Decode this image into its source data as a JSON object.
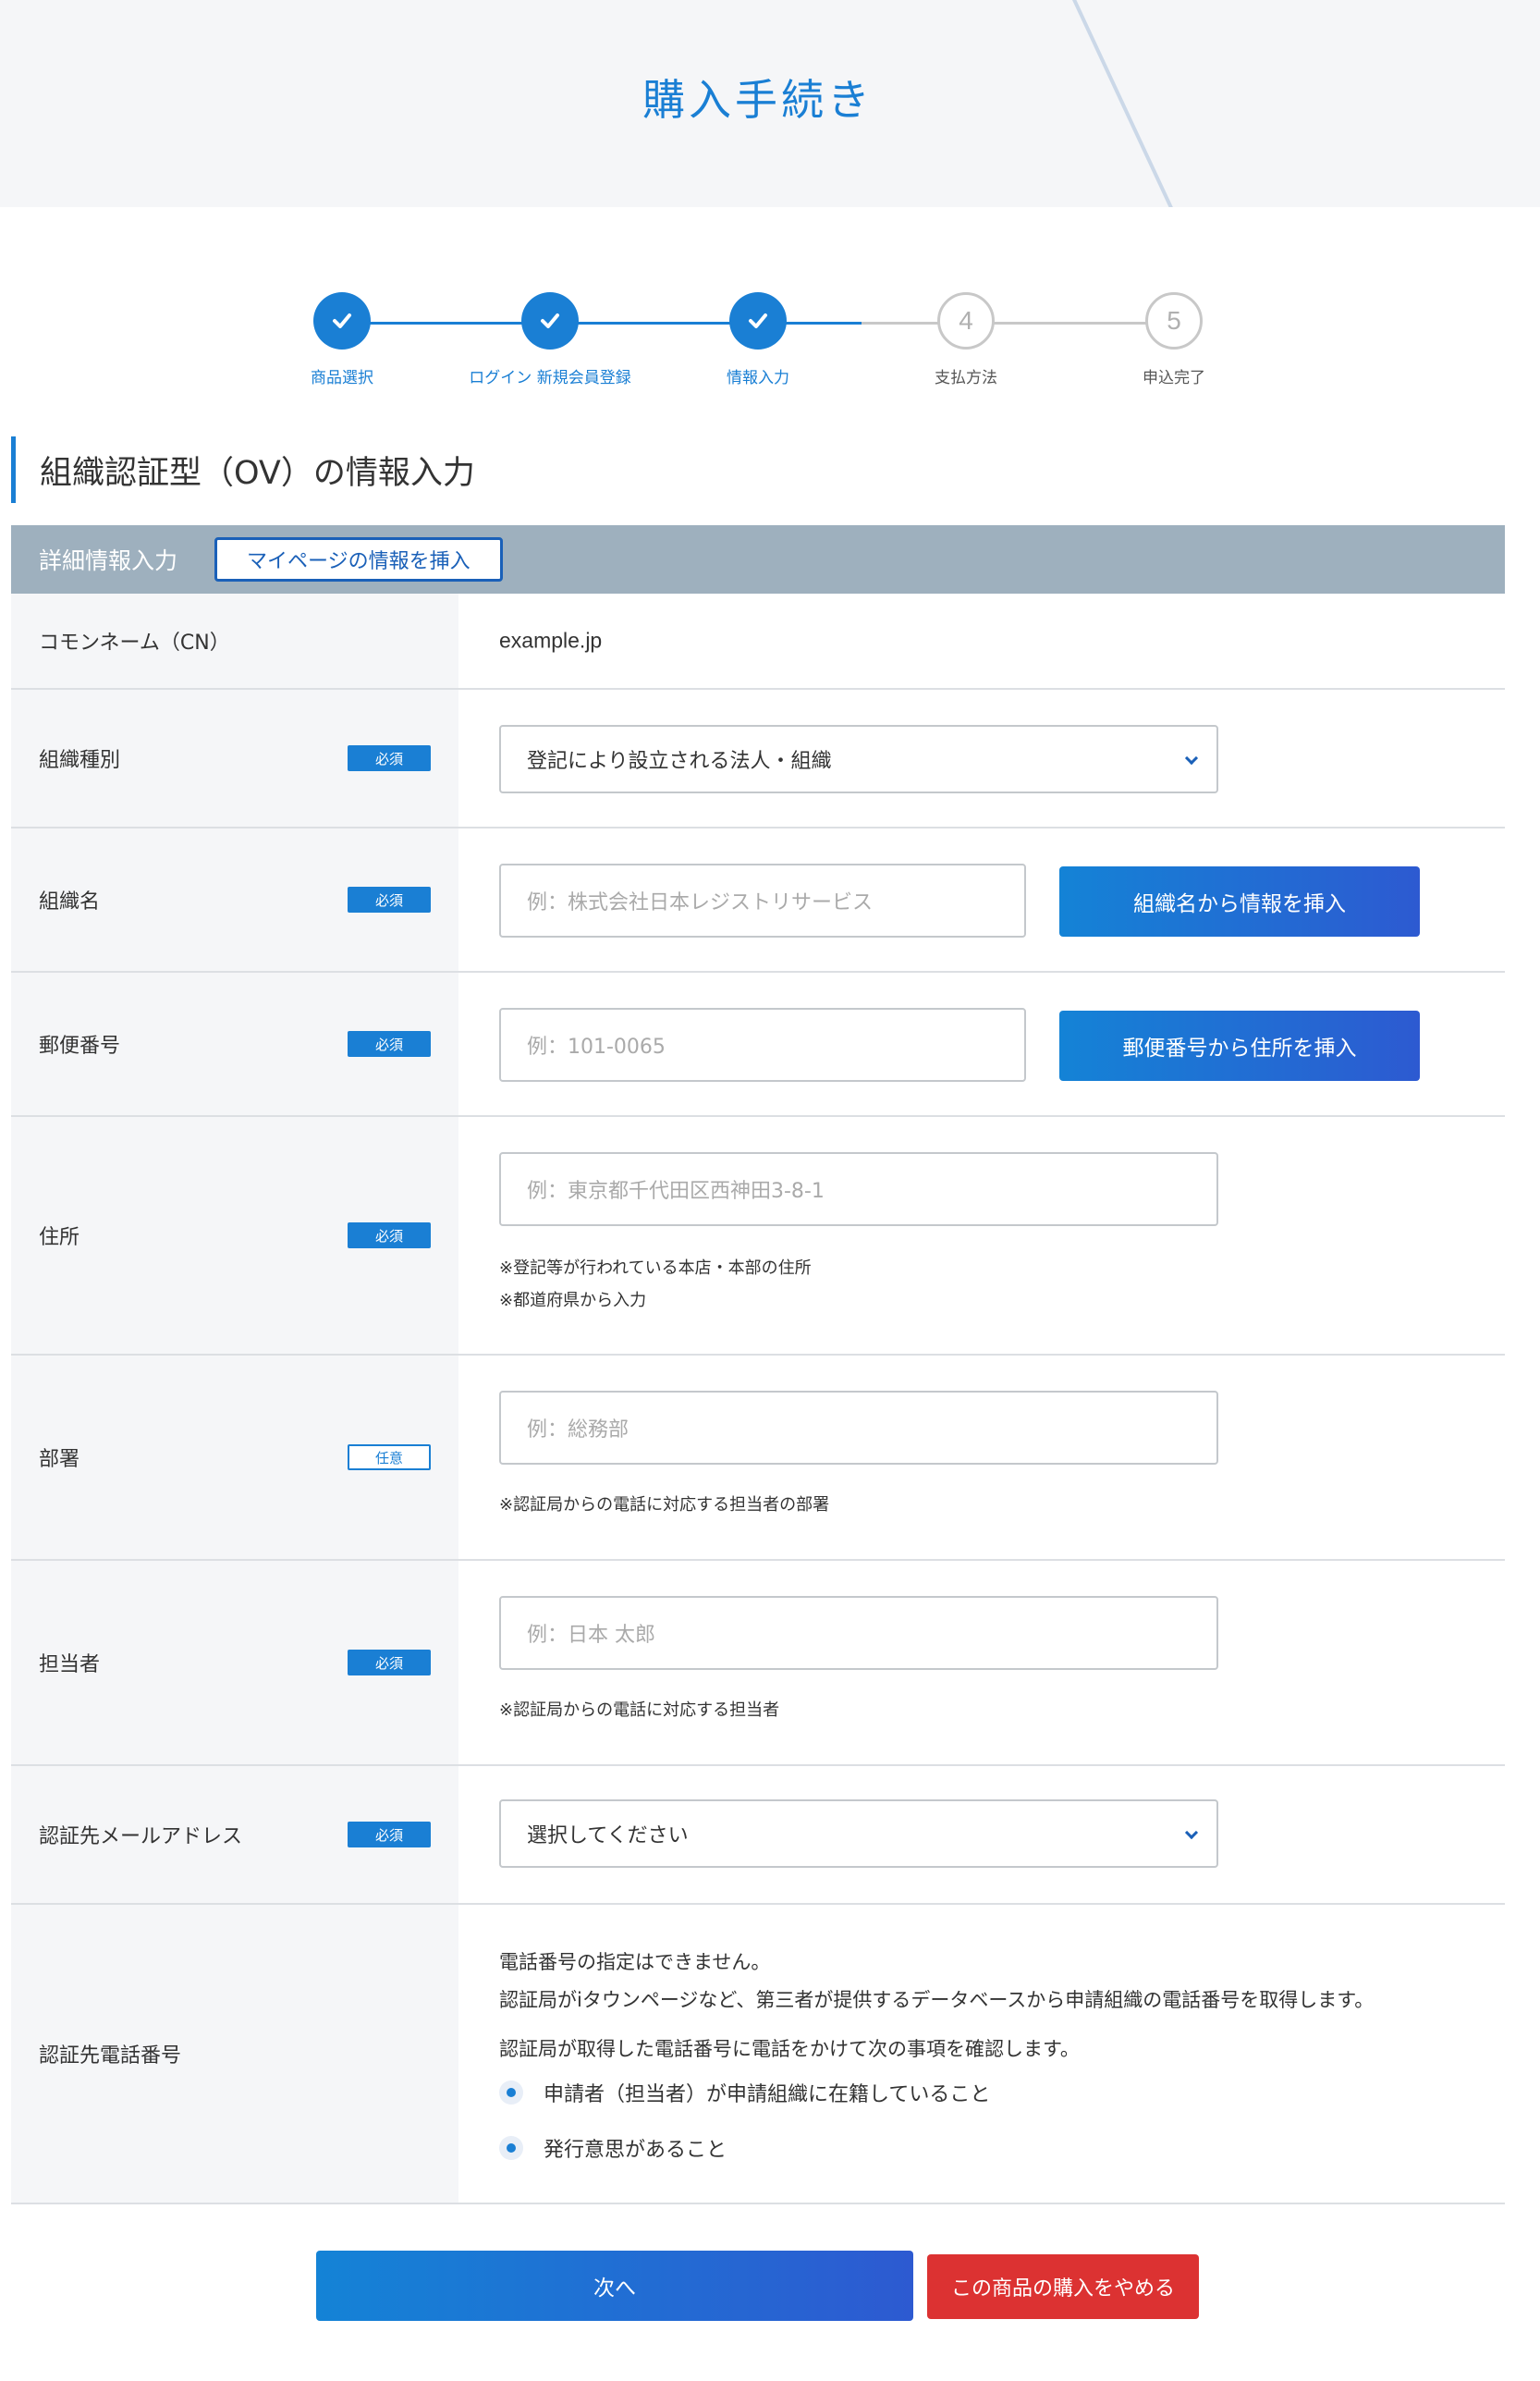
{
  "page": {
    "title": "購入手続き"
  },
  "stepper": {
    "steps": [
      {
        "label": "商品選択",
        "state": "done"
      },
      {
        "label": "ログイン 新規会員登録",
        "state": "done"
      },
      {
        "label": "情報入力",
        "state": "done"
      },
      {
        "label": "支払方法",
        "state": "todo",
        "number": "4"
      },
      {
        "label": "申込完了",
        "state": "todo",
        "number": "5"
      }
    ]
  },
  "section": {
    "heading": "組織認証型（OV）の情報入力"
  },
  "table": {
    "header_title": "詳細情報入力",
    "mypage_button": "マイページの情報を挿入",
    "rows": {
      "cn": {
        "label": "コモンネーム（CN）",
        "value": "example.jp"
      },
      "org_type": {
        "label": "組織種別",
        "badge": "必須",
        "selected": "登記により設立される法人・組織"
      },
      "org_name": {
        "label": "組織名",
        "badge": "必須",
        "placeholder": "例：株式会社日本レジストリサービス",
        "button": "組織名から情報を挿入"
      },
      "postal": {
        "label": "郵便番号",
        "badge": "必須",
        "placeholder": "例：101-0065",
        "button": "郵便番号から住所を挿入"
      },
      "address": {
        "label": "住所",
        "badge": "必須",
        "placeholder": "例：東京都千代田区西神田3-8-1",
        "notes": [
          "※登記等が行われている本店・本部の住所",
          "※都道府県から入力"
        ]
      },
      "department": {
        "label": "部署",
        "badge": "任意",
        "placeholder": "例：総務部",
        "note": "※認証局からの電話に対応する担当者の部署"
      },
      "contact": {
        "label": "担当者",
        "badge": "必須",
        "placeholder": "例：日本 太郎",
        "note": "※認証局からの電話に対応する担当者"
      },
      "email": {
        "label": "認証先メールアドレス",
        "badge": "必須",
        "selected": "選択してください"
      },
      "phone": {
        "label": "認証先電話番号",
        "text_lines": [
          "電話番号の指定はできません。",
          "認証局がiタウンページなど、第三者が提供するデータベースから申請組織の電話番号を取得します。"
        ],
        "confirm_text": "認証局が取得した電話番号に電話をかけて次の事項を確認します。",
        "items": [
          "申請者（担当者）が申請組織に在籍していること",
          "発行意思があること"
        ]
      }
    }
  },
  "footer": {
    "next_button": "次へ",
    "cancel_button": "この商品の購入をやめる"
  },
  "colors": {
    "primary": "#1a7fd4",
    "header_bar": "#9eb0be",
    "danger": "#dc3232"
  }
}
